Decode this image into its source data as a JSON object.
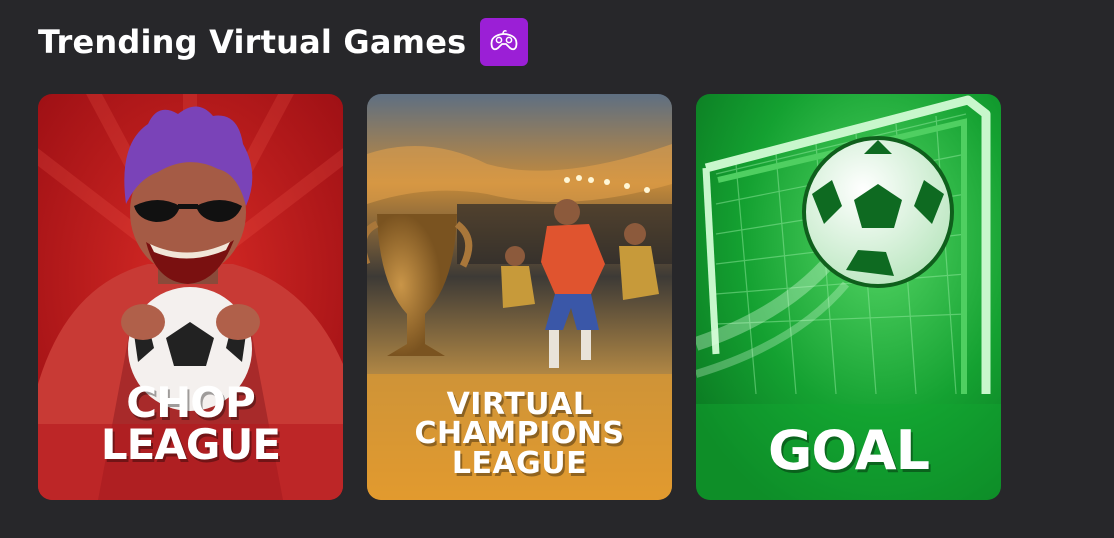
{
  "section": {
    "title": "Trending Virtual Games",
    "badge_icon": "gamepad-icon",
    "badge_color": "#9b1fd6"
  },
  "games": [
    {
      "title": "CHOP\nLEAGUE",
      "theme_color": "#b5161b"
    },
    {
      "title": "VIRTUAL\nCHAMPIONS\nLEAGUE",
      "theme_color": "#e19b2f"
    },
    {
      "title": "GOAL",
      "theme_color": "#12a631"
    }
  ]
}
